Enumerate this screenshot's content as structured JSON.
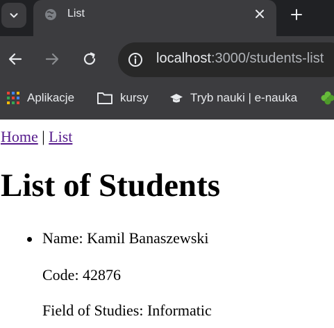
{
  "tab": {
    "title": "List"
  },
  "toolbar": {
    "url_host": "localhost",
    "url_path": ":3000/students-list"
  },
  "bookmarks": [
    {
      "label": "Aplikacje",
      "icon": "apps-grid-icon"
    },
    {
      "label": "kursy",
      "icon": "folder-icon"
    },
    {
      "label": "Tryb nauki | e-nauka",
      "icon": "graduation-cap-icon"
    }
  ],
  "page": {
    "nav": {
      "home": "Home",
      "separator": "|",
      "list": "List"
    },
    "title": "List of Students",
    "students": [
      {
        "name": "Name: Kamil Banaszewski",
        "code": "Code: 42876",
        "field": "Field of Studies: Informatic"
      }
    ]
  },
  "colors": {
    "chrome_dark": "#202124",
    "chrome_toolbar": "#3c3c3f",
    "visited_link": "#551a8b"
  }
}
